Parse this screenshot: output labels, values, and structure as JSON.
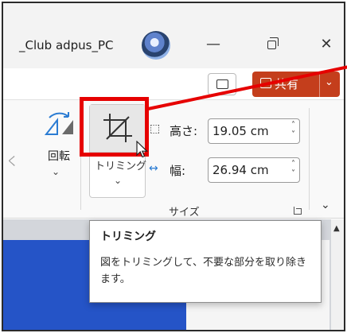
{
  "window": {
    "title": "_Club adpus_PC",
    "minimize_glyph": "—",
    "close_glyph": "✕"
  },
  "toolbar": {
    "share_label": "共有",
    "share_chevron": "⌄"
  },
  "ribbon": {
    "left_fragment": "く",
    "rotate_label": "回転",
    "crop_label": "トリミング",
    "height_label": "高さ:",
    "width_label": "幅:",
    "height_value": "19.05 cm",
    "width_value": "26.94 cm",
    "size_group_label": "サイズ",
    "spin_glyph": "˄\n˅",
    "chevron_glyph": "⌄",
    "collapse_glyph": "⌄"
  },
  "tooltip": {
    "title": "トリミング",
    "description": "図をトリミングして、不要な部分を取り除きます。"
  },
  "colors": {
    "share_button": "#c43e1c",
    "annotation": "#e60000",
    "slide": "#2554c7"
  },
  "icons": {
    "avatar": "avatar",
    "restore": "restore-icon",
    "comment": "comment-icon",
    "share": "share-icon",
    "rotate": "rotate-icon",
    "crop": "crop-icon",
    "height_dimension": "height-icon",
    "width_dimension": "width-icon"
  }
}
